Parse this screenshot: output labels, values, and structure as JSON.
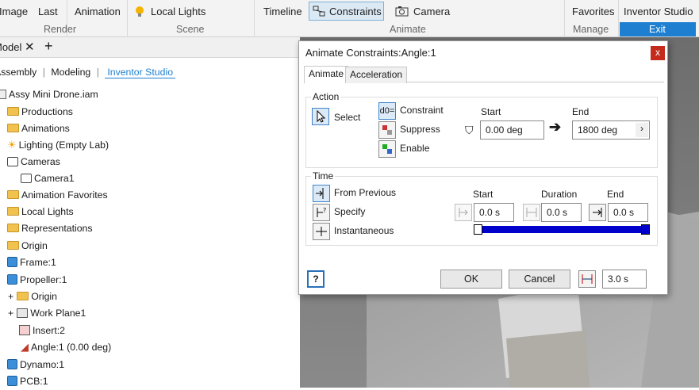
{
  "ribbon": {
    "top_items": [
      "Image",
      "Last",
      "Animation",
      "Local Lights",
      "Timeline",
      "Constraints",
      "Camera",
      "Favorites",
      "Inventor Studio"
    ],
    "panels": [
      "Render",
      "Scene",
      "Animate",
      "Manage",
      "Exit"
    ]
  },
  "browser": {
    "tab_label": "Model",
    "tabs": [
      "Assembly",
      "Modeling",
      "Inventor Studio"
    ],
    "tree": [
      "Assy Mini Drone.iam",
      "Productions",
      "Animations",
      "Lighting (Empty Lab)",
      "Cameras",
      "Camera1",
      "Animation Favorites",
      "Local Lights",
      "Representations",
      "Origin",
      "Frame:1",
      "Propeller:1",
      "Origin",
      "Work Plane1",
      "Insert:2",
      "Angle:1 (0.00 deg)",
      "Dynamo:1",
      "PCB:1"
    ]
  },
  "dialog": {
    "title": "Animate Constraints:Angle:1",
    "close": "x",
    "tabs": [
      "Animate",
      "Acceleration"
    ],
    "action": {
      "label": "Action",
      "select": "Select",
      "options": [
        "Constraint",
        "Suppress",
        "Enable"
      ],
      "start_label": "Start",
      "end_label": "End",
      "start_value": "0.00 deg",
      "end_value": "1800 deg",
      "constraint_icon_text": "d0="
    },
    "time": {
      "label": "Time",
      "options": [
        "From Previous",
        "Specify",
        "Instantaneous"
      ],
      "start_label": "Start",
      "duration_label": "Duration",
      "end_label": "End",
      "start_value": "0.0 s",
      "duration_value": "0.0 s",
      "end_value": "0.0 s",
      "slider_fraction": 1.0
    },
    "ok": "OK",
    "cancel": "Cancel",
    "total_time": "3.0 s",
    "help_icon_text": "?"
  },
  "colors": {
    "accent": "#1e7fd1",
    "slider": "#0000cc",
    "close": "#c42b1c"
  }
}
